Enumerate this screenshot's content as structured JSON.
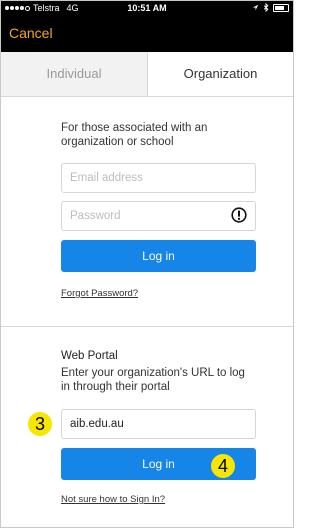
{
  "status": {
    "carrier": "Telstra",
    "network": "4G",
    "time": "10:51 AM"
  },
  "nav": {
    "cancel_label": "Cancel"
  },
  "tabs": [
    {
      "label": "Individual"
    },
    {
      "label": "Organization"
    }
  ],
  "org": {
    "description": "For those associated with an organization or school",
    "email_placeholder": "Email address",
    "password_placeholder": "Password",
    "login_label": "Log in",
    "forgot_label": "Forgot Password?"
  },
  "portal": {
    "heading": "Web Portal",
    "description": "Enter your organization's URL to log in through their portal",
    "url_value": "aib.edu.au",
    "login_label": "Log in",
    "help_label": "Not sure how to Sign In?"
  },
  "annotations": {
    "step3": "3",
    "step4": "4"
  },
  "colors": {
    "accent": "#1585e8",
    "cancel": "#f5a623",
    "badge": "#f7e600"
  }
}
